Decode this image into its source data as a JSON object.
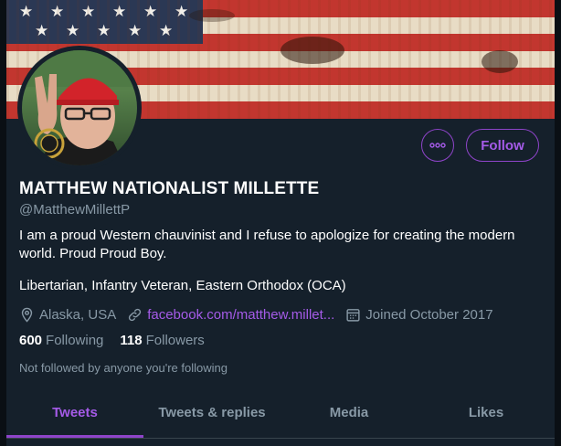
{
  "profile": {
    "name": "MATTHEW NATIONALIST MILLETTE",
    "handle": "@MatthewMillettP",
    "bio_line1": "I am a proud Western chauvinist and I refuse to apologize for creating the modern world. Proud Proud Boy.",
    "bio_line2": "Libertarian, Infantry Veteran, Eastern Orthodox (OCA)",
    "location": "Alaska, USA",
    "website": "facebook.com/matthew.millet...",
    "joined": "Joined October 2017",
    "following_count": "600",
    "following_label": "Following",
    "followers_count": "118",
    "followers_label": "Followers",
    "not_followed": "Not followed by anyone you're following"
  },
  "actions": {
    "follow_label": "Follow",
    "more_icon": "more-horizontal-icon"
  },
  "tabs": [
    {
      "label": "Tweets",
      "active": true
    },
    {
      "label": "Tweets & replies",
      "active": false
    },
    {
      "label": "Media",
      "active": false
    },
    {
      "label": "Likes",
      "active": false
    }
  ],
  "colors": {
    "background": "#15202b",
    "accent": "#a55be8",
    "secondary_text": "#8899a6"
  }
}
